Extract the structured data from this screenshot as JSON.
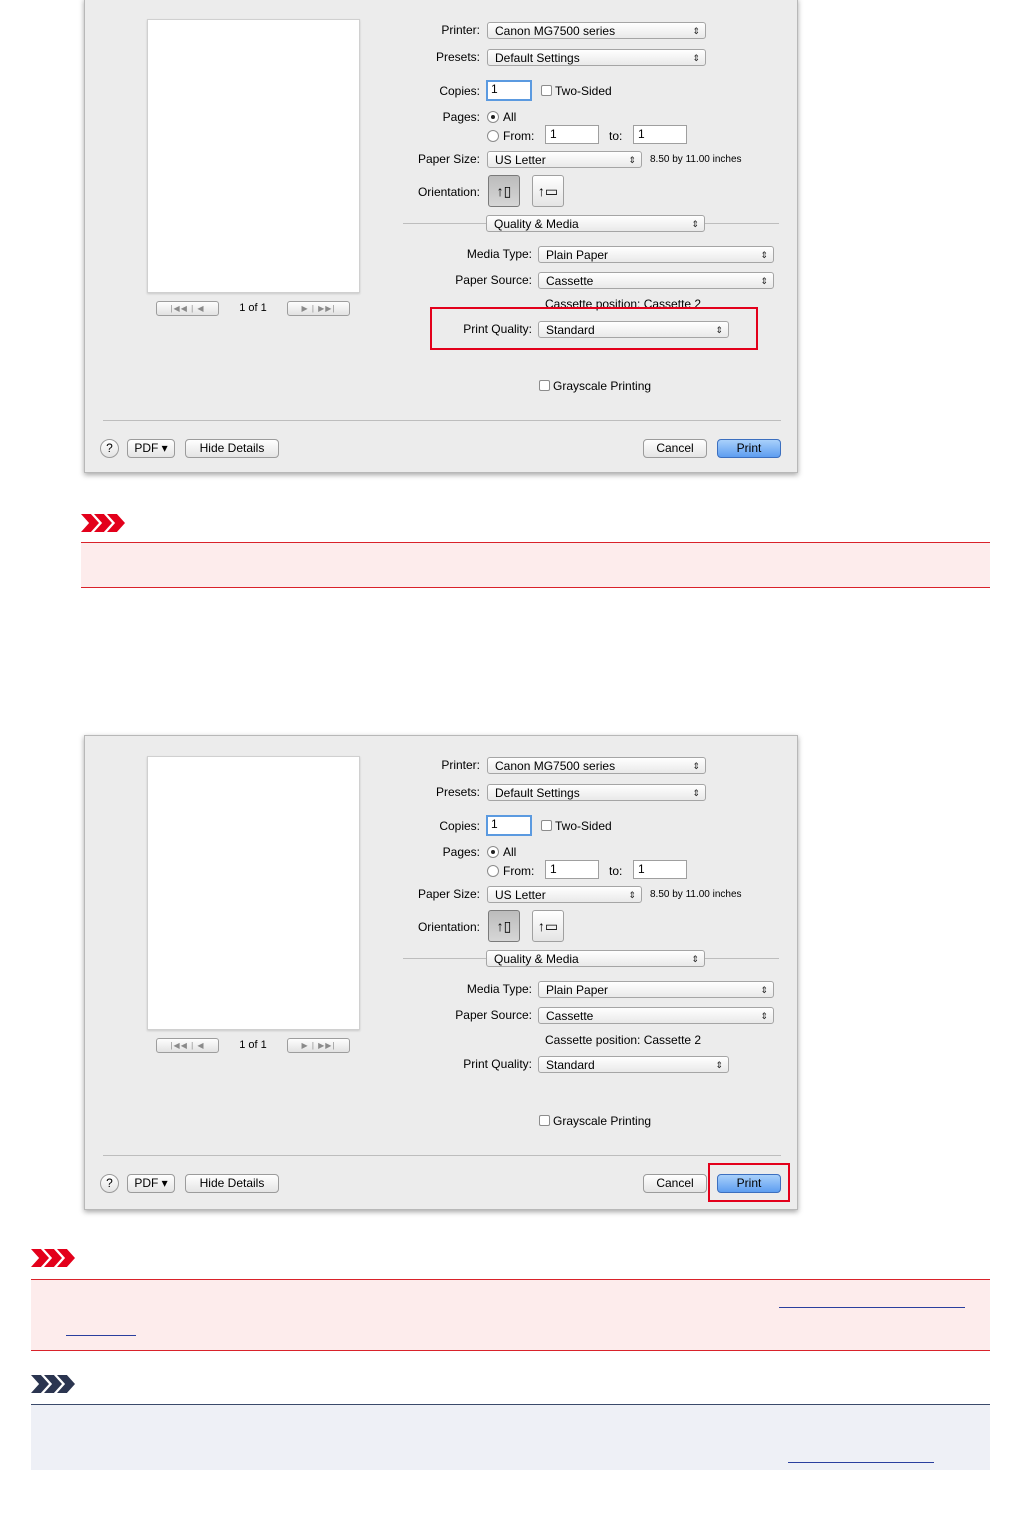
{
  "dialog": {
    "printer_label": "Printer:",
    "printer_value": "Canon MG7500 series",
    "presets_label": "Presets:",
    "presets_value": "Default Settings",
    "copies_label": "Copies:",
    "copies_value": "1",
    "two_sided_label": "Two-Sided",
    "pages_label": "Pages:",
    "pages_all_label": "All",
    "pages_from_label": "From:",
    "pages_from_value": "1",
    "pages_to_label": "to:",
    "pages_to_value": "1",
    "paper_size_label": "Paper Size:",
    "paper_size_value": "US Letter",
    "paper_size_dims": "8.50 by 11.00 inches",
    "orientation_label": "Orientation:",
    "section_value": "Quality & Media",
    "media_type_label": "Media Type:",
    "media_type_value": "Plain Paper",
    "paper_source_label": "Paper Source:",
    "paper_source_value": "Cassette",
    "cassette_position": "Cassette position: Cassette 2",
    "print_quality_label": "Print Quality:",
    "print_quality_value": "Standard",
    "grayscale_label": "Grayscale Printing",
    "page_counter": "1 of 1",
    "help_label": "?",
    "pdf_label": "PDF ▾",
    "hide_details_label": "Hide Details",
    "cancel_label": "Cancel",
    "print_label": "Print"
  },
  "colors": {
    "highlight": "#e3001b",
    "important_bg": "#fdecec",
    "important_rule": "#d9222a",
    "note_bg": "#eef0f6",
    "note_rule": "#3a4a6b"
  },
  "icons": {
    "important": "important-chevrons-icon",
    "note": "note-chevrons-icon"
  }
}
